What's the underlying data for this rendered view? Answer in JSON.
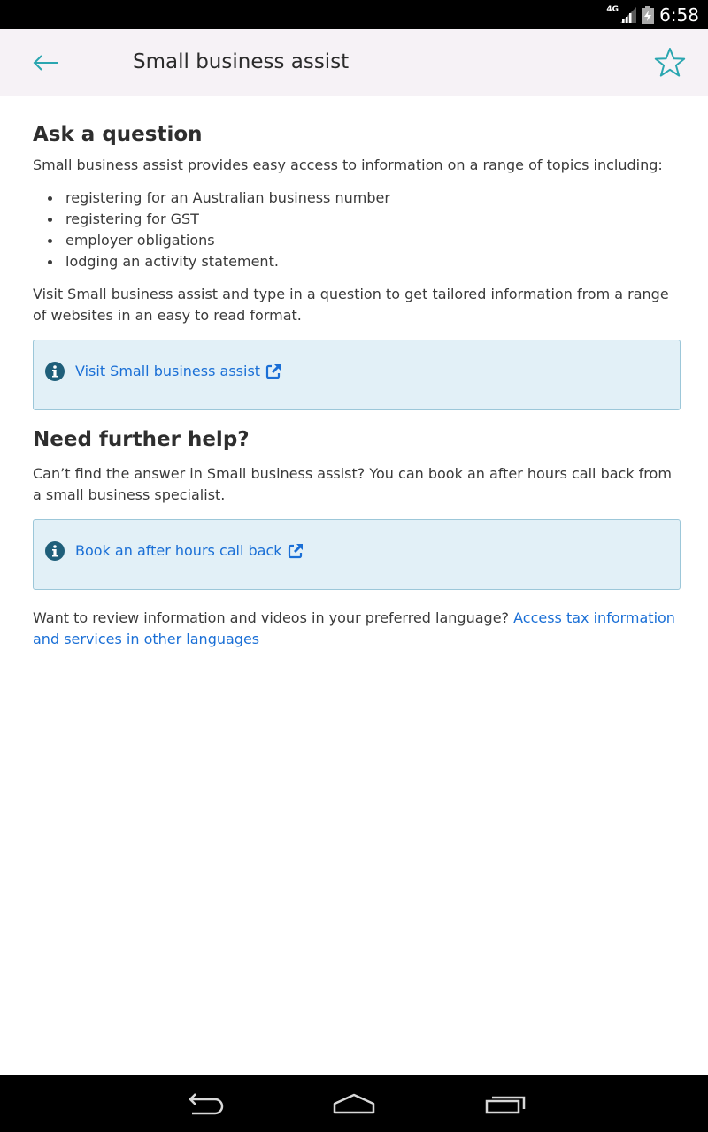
{
  "status_bar": {
    "network": "4G",
    "time": "6:58"
  },
  "app_bar": {
    "title": "Small business assist",
    "back_icon": "arrow-back-icon",
    "favorite_icon": "star-outline-icon",
    "accent_color": "#2aa6b0"
  },
  "sections": {
    "ask": {
      "heading": "Ask a question",
      "intro": "Small business assist provides easy access to information on a range of topics including:",
      "topics": [
        "registering for an Australian business number",
        "registering for GST",
        "employer obligations",
        "lodging an activity statement."
      ],
      "visit_text": "Visit Small business assist and type in a question to get tailored information from a range of websites in an easy to read format.",
      "link_label": "Visit Small business assist"
    },
    "help": {
      "heading": "Need further help?",
      "text": "Can’t find the answer in Small business assist? You can book an after hours call back from a small business specialist.",
      "link_label": "Book an after hours call back"
    },
    "language": {
      "text": "Want to review information and videos in your preferred language? ",
      "link_label": "Access tax information and services in other languages"
    }
  },
  "colors": {
    "link": "#1a6fd6",
    "info_box_bg": "#e2f0f7",
    "info_box_border": "#9cc7d9",
    "info_icon": "#1f5f7a"
  },
  "icons": {
    "info": "info-icon",
    "external_link": "external-link-icon"
  },
  "nav_bar": {
    "back": "nav-back-icon",
    "home": "nav-home-icon",
    "recent": "nav-recent-apps-icon"
  }
}
